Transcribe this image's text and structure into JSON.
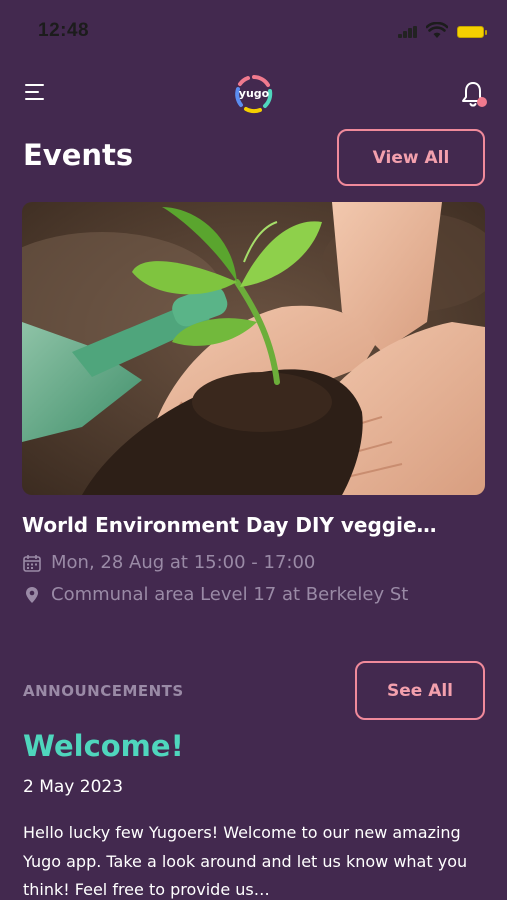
{
  "status_bar": {
    "time": "12:48"
  },
  "header": {
    "logo_text": "yugo",
    "menu_icon": "hamburger-menu-icon",
    "notification_icon": "bell-icon",
    "notification_dot_color": "#f07a8e"
  },
  "events": {
    "title": "Events",
    "view_all_label": "View All",
    "card": {
      "title": "World Environment Day DIY veggie…",
      "date": "Mon, 28 Aug at 15:00 - 17:00",
      "location": "Communal area Level 17 at Berkeley St",
      "date_icon": "calendar-icon",
      "location_icon": "location-pin-icon"
    }
  },
  "announcements": {
    "label": "ANNOUNCEMENTS",
    "see_all_label": "See All",
    "item": {
      "title": "Welcome!",
      "date": "2 May 2023",
      "body": "Hello lucky few Yugoers! Welcome to our new amazing Yugo app. Take a look around and let us know what you think! Feel free to provide us…"
    }
  },
  "colors": {
    "background": "#43294f",
    "accent_pink": "#f08a9b",
    "accent_teal": "#4fd6bd",
    "muted_text": "#9a8aa6"
  }
}
